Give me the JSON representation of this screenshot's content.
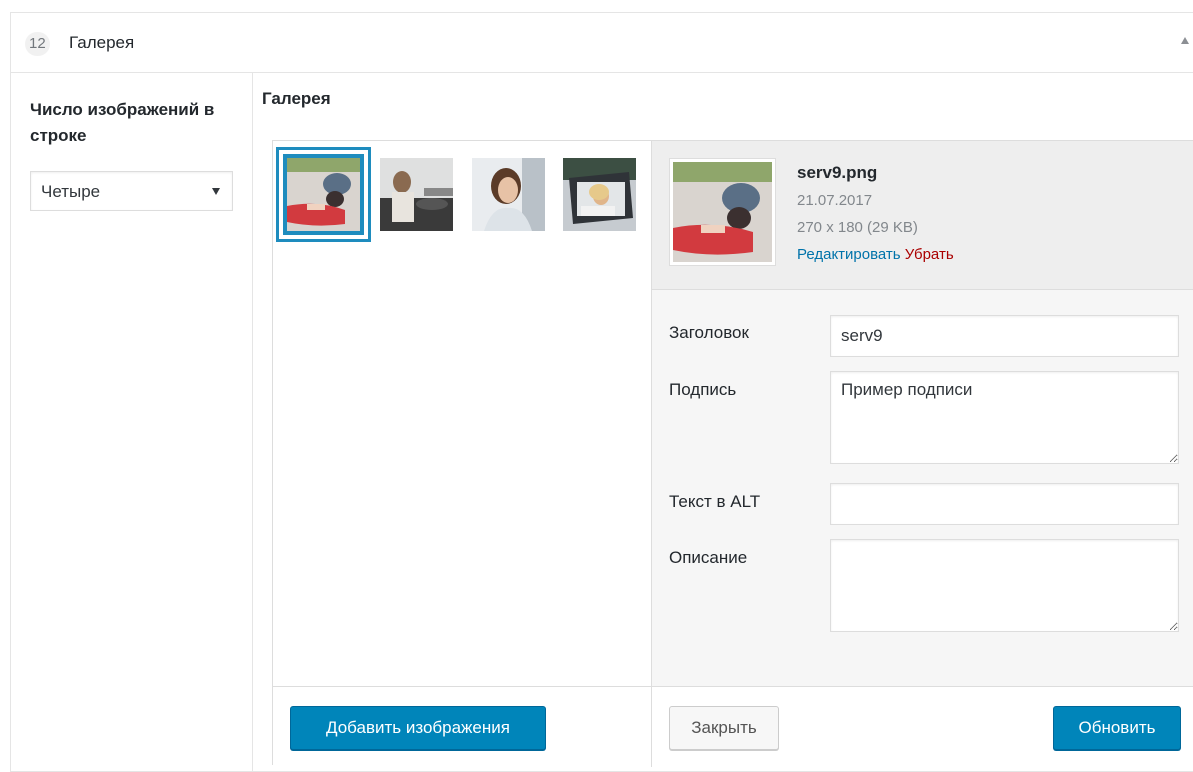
{
  "metabox": {
    "count": "12",
    "title": "Галерея"
  },
  "settings": {
    "columns_label": "Число изображений в строке",
    "columns_value": "Четыре"
  },
  "gallery": {
    "label": "Галерея",
    "thumbnails": [
      "serv9",
      "image-2",
      "image-3",
      "image-4"
    ]
  },
  "selected": {
    "filename": "serv9.png",
    "date": "21.07.2017",
    "dimensions": "270 x 180 (29 KB)",
    "edit_label": "Редактировать",
    "remove_label": "Убрать"
  },
  "fields": {
    "title_label": "Заголовок",
    "title_value": "serv9",
    "caption_label": "Подпись",
    "caption_value": "Пример подписи",
    "alt_label": "Текст в ALT",
    "alt_value": "",
    "description_label": "Описание",
    "description_value": ""
  },
  "buttons": {
    "add_images": "Добавить изображения",
    "close": "Закрыть",
    "update": "Обновить"
  },
  "colors": {
    "accent": "#0085ba",
    "selection": "#1e8cbe",
    "link": "#0073aa",
    "danger": "#a00"
  }
}
